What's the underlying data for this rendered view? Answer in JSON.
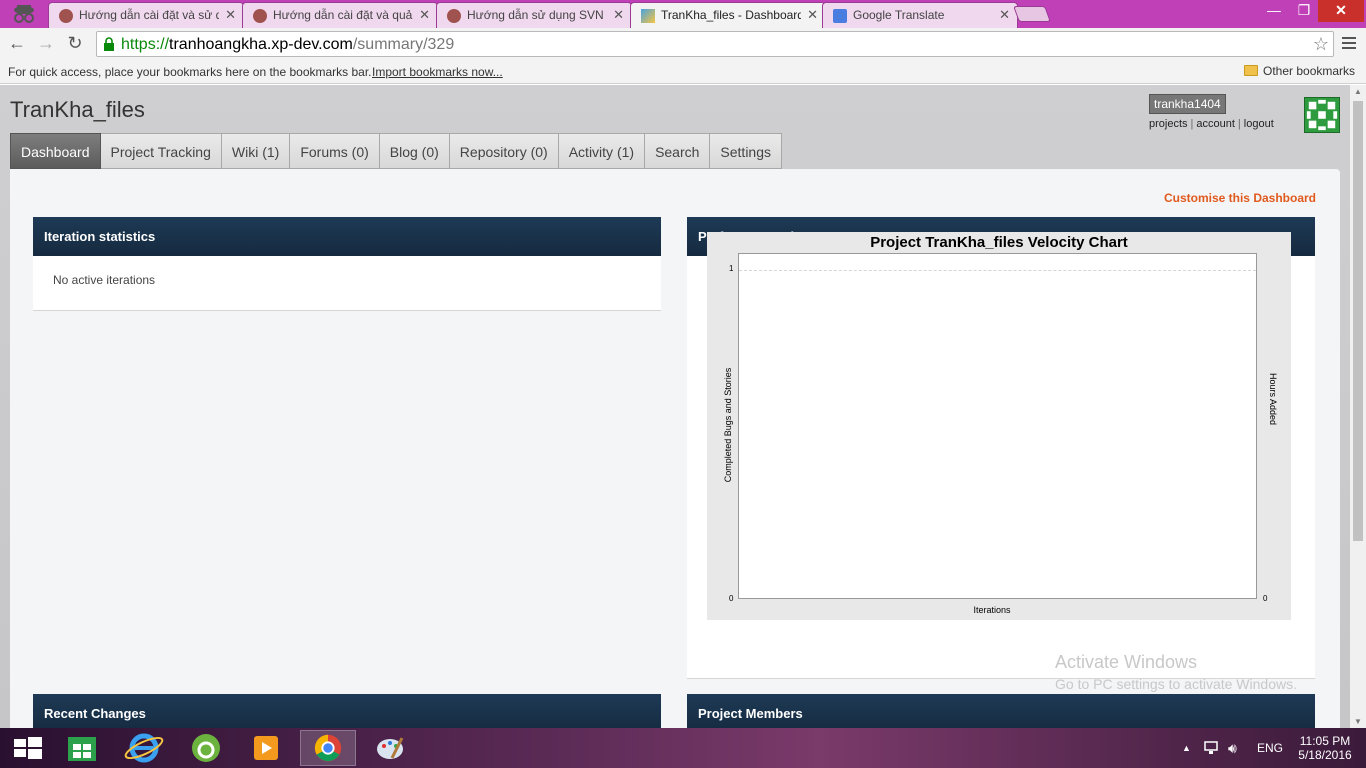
{
  "browser": {
    "tabs": [
      {
        "title": "Hướng dẫn cài đặt và sử d",
        "active": false
      },
      {
        "title": "Hướng dẫn cài đặt và quả",
        "active": false
      },
      {
        "title": "Hướng dẫn sử dụng SVN",
        "active": false
      },
      {
        "title": "TranKha_files - Dashboard",
        "active": true
      },
      {
        "title": "Google Translate",
        "active": false
      }
    ],
    "url": {
      "scheme": "https://",
      "host": "tranhoangkha.xp-dev.com",
      "path": "/summary/329"
    },
    "bookmarks": {
      "prompt": "For quick access, place your bookmarks here on the bookmarks bar.",
      "import_link": "Import bookmarks now...",
      "other": "Other bookmarks"
    }
  },
  "header": {
    "project_title": "TranKha_files",
    "username": "trankha1404",
    "user_links": [
      "projects",
      "account",
      "logout"
    ]
  },
  "nav": {
    "tabs": [
      "Dashboard",
      "Project Tracking",
      "Wiki (1)",
      "Forums (0)",
      "Blog (0)",
      "Repository (0)",
      "Activity (1)",
      "Search",
      "Settings"
    ],
    "active": "Dashboard"
  },
  "dashboard": {
    "customise_link": "Customise this Dashboard",
    "iteration_panel": {
      "title": "Iteration statistics",
      "body": "No active iterations"
    },
    "performance_panel": {
      "title": "Performance Charts"
    },
    "recent_panel": {
      "title": "Recent Changes"
    },
    "members_panel": {
      "title": "Project Members"
    }
  },
  "chart_data": {
    "type": "bar",
    "title": "Project TranKha_files Velocity Chart",
    "xlabel": "Iterations",
    "ylabel": "Completed Bugs and Stories",
    "y2label": "Hours Added",
    "ylim": [
      0,
      1
    ],
    "y2lim": [
      0,
      0
    ],
    "y_ticks": [
      "0",
      "1"
    ],
    "y2_ticks": [
      "0"
    ],
    "categories": [],
    "series": [],
    "grid": true
  },
  "watermark": {
    "line1": "Activate Windows",
    "line2": "Go to PC settings to activate Windows."
  },
  "taskbar": {
    "language": "ENG",
    "time": "11:05 PM",
    "date": "5/18/2016"
  },
  "colors": {
    "tabstrip": "#c040b8",
    "panel_header": "#1e3a56",
    "customise_link": "#e05a1e",
    "nav_active": "#6b6b6b"
  }
}
